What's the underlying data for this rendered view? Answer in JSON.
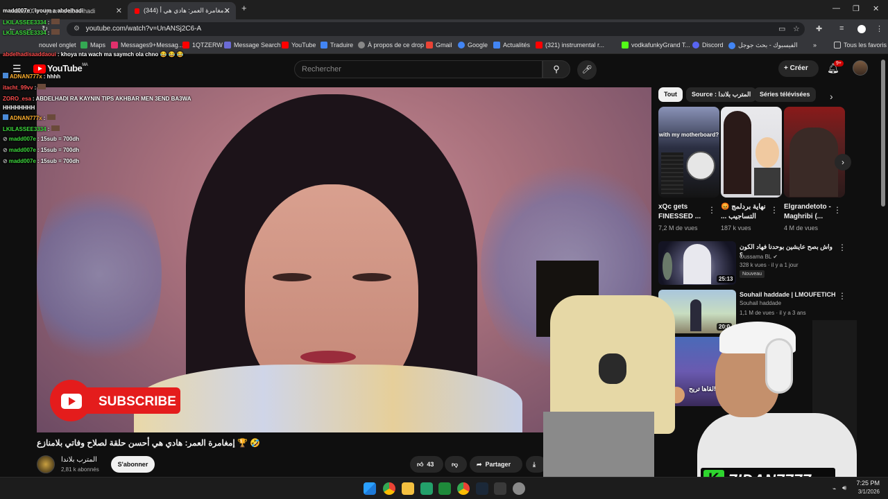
{
  "browser": {
    "tabs": [
      {
        "label": "madd007e : iyoum a abdelhadi",
        "active": false
      },
      {
        "label": "(344) مغامرة العمر: هادي هي أ...",
        "active": true
      }
    ],
    "new_tab": "+",
    "url": "youtube.com/watch?v=UnANSj2C6-A",
    "bookmarks": [
      {
        "label": "nouvel onglet",
        "color": "#888"
      },
      {
        "label": "Maps",
        "color": "#34a853"
      },
      {
        "label": "Messages9+Messag...",
        "color": "#e1306c"
      },
      {
        "label": "1QTZERW",
        "color": "#ff0000"
      },
      {
        "label": "Message Search",
        "color": "#6b6bd6"
      },
      {
        "label": "YouTube",
        "color": "#ff0000"
      },
      {
        "label": "Traduire",
        "color": "#4285f4"
      },
      {
        "label": "À propos de ce drop",
        "color": "#888"
      },
      {
        "label": "Gmail",
        "color": "#ea4335"
      },
      {
        "label": "Google",
        "color": "#4285f4"
      },
      {
        "label": "Actualités",
        "color": "#4285f4"
      },
      {
        "label": "(321) instrumental r...",
        "color": "#ff0000"
      },
      {
        "label": "vodkafunkyGrand T...",
        "color": "#53fc18"
      },
      {
        "label": "Discord",
        "color": "#5865f2"
      },
      {
        "label": "الفيسبوك - بحث جوجل",
        "color": "#4285f4"
      }
    ],
    "bookmarks_more": "»",
    "all_favorites": "Tous les favoris"
  },
  "youtube": {
    "logo": "YouTube",
    "country": "MA",
    "search_placeholder": "Rechercher",
    "create_label": "Créer",
    "notif_count": "9+",
    "video_title": "🤣 🏆 إمغامرة العمر: هادي هي أحسن حلقة لصلاح وفاتي بلامنازع",
    "channel_name": "المترب بلاندا",
    "channel_subs": "2,81 k abonnés",
    "subscribe_label": "S'abonner",
    "like_count": "43",
    "share_label": "Partager",
    "overlay_subscribe": "SUBSCRIBE",
    "chips": [
      {
        "label": "Tout",
        "selected": true
      },
      {
        "label": "Source : المترب بلاندا",
        "selected": false
      },
      {
        "label": "Séries télévisées",
        "selected": false
      }
    ],
    "shorts": [
      {
        "title": "xQc gets FINESSED ...",
        "views": "7,2 M de vues",
        "caption": "with my motherboard?"
      },
      {
        "title": "نهاية بردلمج 😡 التساجيب ...",
        "views": "187 k vues",
        "caption": ""
      },
      {
        "title": "Elgrandetoto - Maghribi (...",
        "views": "4 M de vues",
        "caption": ""
      }
    ],
    "recommendations": [
      {
        "title": "واش بصح عايشين بوحدنا فهاد الكون ؟",
        "channel": "Oussama BL",
        "meta": "328 k vues · il y a 1 jour",
        "duration": "25:13",
        "badge": "Nouveau"
      },
      {
        "title": "Souhail haddade | LMOUFETICH",
        "channel": "Souhail haddade",
        "meta": "1,1 M de vues · il y a 3 ans",
        "duration": "20:0"
      },
      {
        "title": "",
        "channel": "",
        "meta": "",
        "duration": "",
        "thumb_text": "لقاها تريح!!"
      }
    ]
  },
  "chat": [
    {
      "name": "LKILASSEE3334",
      "msg": "",
      "color": "#3ddc3d"
    },
    {
      "name": "LKILASSEE3334",
      "msg": "",
      "color": "#3ddc3d"
    },
    {
      "name": "abdelhadisaaddaoui",
      "msg": "khoya nta wach ma saymch ola chno 😂 😂 😂",
      "color": "#ff4d4d"
    },
    {
      "name": "ADNAN777x",
      "msg": "hhhh",
      "color": "#ffb02e"
    },
    {
      "name": "itacht_99vv",
      "msg": "",
      "color": "#ff4d4d"
    },
    {
      "name": "ZORO_esa",
      "msg": "ABDELHADI RA KAYNIN TIPS AKHBAR MEN 3END BA3WA HHHHHHHH",
      "color": "#ff4d4d"
    },
    {
      "name": "ADNAN777x",
      "msg": "",
      "color": "#ffb02e"
    },
    {
      "name": "LKILASSEE3334",
      "msg": "",
      "color": "#3ddc3d"
    },
    {
      "name": "madd007e",
      "msg": "15sub = 700dh",
      "color": "#3ddc3d"
    },
    {
      "name": "madd007e",
      "msg": "15sub = 700dh",
      "color": "#3ddc3d"
    },
    {
      "name": "madd007e",
      "msg": "15sub = 700dh",
      "color": "#3ddc3d"
    }
  ],
  "streamer": {
    "name": "7IDAN7777",
    "badge_letter": "K"
  },
  "taskbar": {
    "time": "7:25 PM",
    "date": "3/1/2026"
  }
}
